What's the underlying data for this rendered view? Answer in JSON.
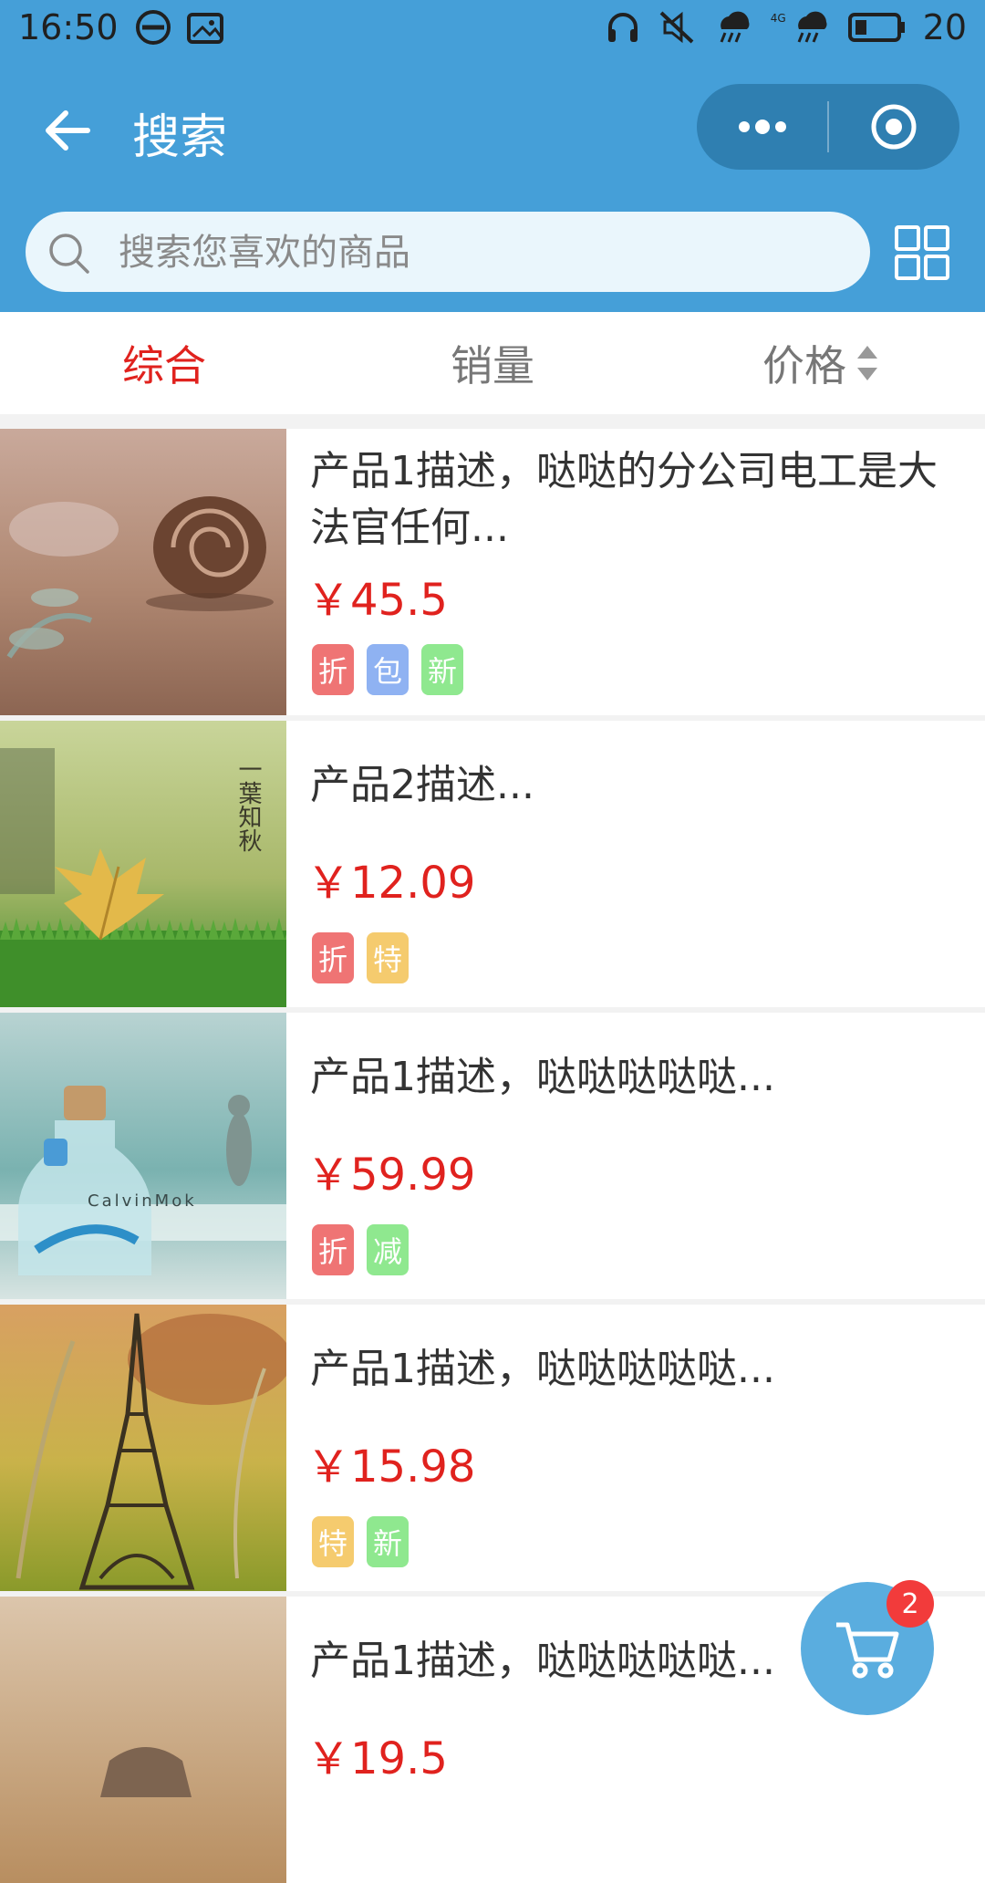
{
  "status_bar": {
    "time": "16:50",
    "battery_text": "20",
    "network_label": "4G",
    "icons": [
      "app-notification-icon",
      "gallery-icon",
      "headset-icon",
      "mute-icon",
      "rain-icon",
      "rain-icon",
      "battery-icon"
    ]
  },
  "nav": {
    "title": "搜索",
    "back_icon": "back-arrow-icon",
    "more_icon": "more-dots-icon",
    "close_icon": "target-close-icon"
  },
  "search": {
    "placeholder": "搜索您喜欢的商品",
    "value": ""
  },
  "tabs": [
    {
      "label": "综合",
      "active": true
    },
    {
      "label": "销量",
      "active": false
    },
    {
      "label": "价格",
      "active": false
    }
  ],
  "products": [
    {
      "desc": "产品1描述，哒哒的分公司电工是大法官任何...",
      "price": "￥45.5",
      "tags": [
        "折",
        "包",
        "新"
      ],
      "image": "snail-shell-photo"
    },
    {
      "desc": "产品2描述...",
      "price": "￥12.09",
      "tags": [
        "折",
        "特"
      ],
      "image": "autumn-leaf-photo",
      "image_text": "一葉知秋"
    },
    {
      "desc": "产品1描述，哒哒哒哒哒...",
      "price": "￥59.99",
      "tags": [
        "折",
        "减"
      ],
      "image": "message-bottle-photo",
      "image_text": "CalvinMok"
    },
    {
      "desc": "产品1描述，哒哒哒哒哒...",
      "price": "￥15.98",
      "tags": [
        "特",
        "新"
      ],
      "image": "eiffel-tower-photo"
    },
    {
      "desc": "产品1描述，哒哒哒哒哒...",
      "price": "￥19.5",
      "tags": [],
      "image": "desert-photo"
    }
  ],
  "tag_colors": {
    "折": "#ef7474",
    "包": "#8fb2f2",
    "新": "#8fe88f",
    "特": "#f5cb6e",
    "减": "#8fe88f"
  },
  "colors": {
    "accent": "#459fd8",
    "price": "#e0221e",
    "active_tab": "#e0221e"
  },
  "cart": {
    "badge": "2"
  }
}
